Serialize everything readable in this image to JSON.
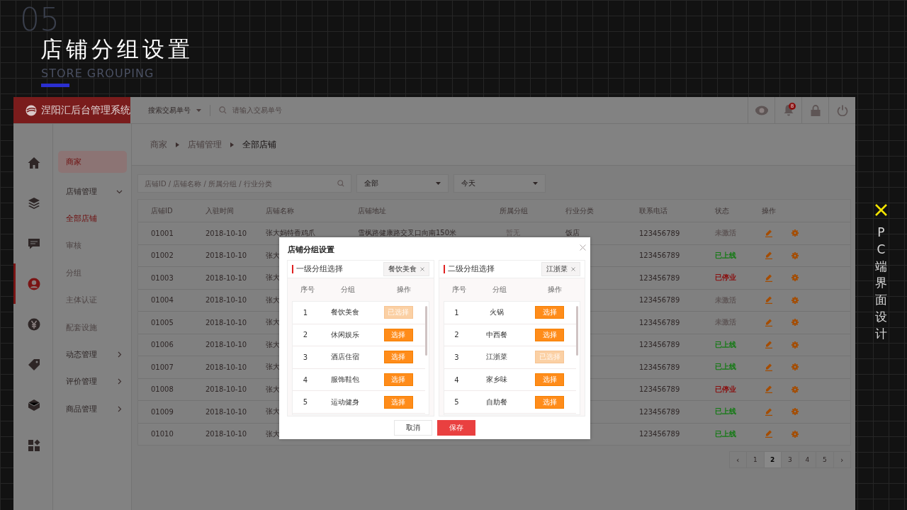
{
  "slide": {
    "number": "05",
    "title": "店铺分组设置",
    "subtitle": "STORE GROUPING",
    "side_caption": "PC端界面设计"
  },
  "app": {
    "brand": "涅阳汇后台管理系统",
    "top_bar": {
      "search_type": "搜索交易单号",
      "search_placeholder": "请输入交易单号",
      "notification_count": "8"
    },
    "rail": [
      {
        "kind": "home",
        "selected": false
      },
      {
        "kind": "layers",
        "selected": false
      },
      {
        "kind": "chat",
        "selected": false
      },
      {
        "kind": "user",
        "selected": true
      },
      {
        "kind": "yen",
        "selected": false
      },
      {
        "kind": "tag",
        "selected": false
      },
      {
        "kind": "cube",
        "selected": false
      },
      {
        "kind": "grid",
        "selected": false
      }
    ],
    "menu": [
      {
        "label": "商家",
        "kind": "link",
        "selected": true
      },
      {
        "label": "店铺管理",
        "kind": "group",
        "expanded": true,
        "children": [
          {
            "label": "全部店铺",
            "selected": true
          },
          {
            "label": "审核",
            "selected": false
          },
          {
            "label": "分组",
            "selected": false
          },
          {
            "label": "主体认证",
            "selected": false
          },
          {
            "label": "配套设施",
            "selected": false
          }
        ]
      },
      {
        "label": "动态管理",
        "kind": "group",
        "expanded": false
      },
      {
        "label": "评价管理",
        "kind": "group",
        "expanded": false
      },
      {
        "label": "商品管理",
        "kind": "group",
        "expanded": false
      }
    ],
    "breadcrumb": [
      "商家",
      "店铺管理",
      "全部店铺"
    ],
    "filters": {
      "search_placeholder": "店铺ID / 店铺名称 / 所属分组 / 行业分类",
      "category": "全部",
      "date": "今天"
    },
    "table": {
      "columns": [
        "店铺ID",
        "入驻时间",
        "店铺名称",
        "店铺地址",
        "所属分组",
        "行业分类",
        "联系电话",
        "状态",
        "操作"
      ],
      "rows": [
        {
          "id": "01001",
          "date": "2018-10-10",
          "name": "张大妈特香鸡爪",
          "address": "雪枫路健康路交叉口向南150米",
          "group": "暂无",
          "industry": "饭店",
          "phone": "123456789",
          "status": {
            "text": "未激活",
            "color": "#5f5757"
          }
        },
        {
          "id": "01002",
          "date": "2018-10-10",
          "name": "张大",
          "phone": "123456789",
          "status": {
            "text": "已上线",
            "color": "#127a12"
          }
        },
        {
          "id": "01003",
          "date": "2018-10-10",
          "name": "张大",
          "phone": "123456789",
          "status": {
            "text": "已停业",
            "color": "#8a0f0f"
          }
        },
        {
          "id": "01004",
          "date": "2018-10-10",
          "name": "张大",
          "phone": "123456789",
          "status": {
            "text": "未激活",
            "color": "#5f5757"
          }
        },
        {
          "id": "01005",
          "date": "2018-10-10",
          "name": "张大",
          "phone": "123456789",
          "status": {
            "text": "未激活",
            "color": "#5f5757"
          }
        },
        {
          "id": "01006",
          "date": "2018-10-10",
          "name": "张大",
          "phone": "123456789",
          "status": {
            "text": "已上线",
            "color": "#127a12"
          }
        },
        {
          "id": "01007",
          "date": "2018-10-10",
          "name": "张大",
          "phone": "123456789",
          "status": {
            "text": "已上线",
            "color": "#127a12"
          }
        },
        {
          "id": "01008",
          "date": "2018-10-10",
          "name": "张大",
          "phone": "123456789",
          "status": {
            "text": "已停业",
            "color": "#8a0f0f"
          }
        },
        {
          "id": "01009",
          "date": "2018-10-10",
          "name": "张大",
          "phone": "123456789",
          "status": {
            "text": "已上线",
            "color": "#127a12"
          }
        },
        {
          "id": "01010",
          "date": "2018-10-10",
          "name": "张大",
          "phone": "123456789",
          "status": {
            "text": "已上线",
            "color": "#127a12"
          }
        }
      ]
    },
    "pagination": [
      {
        "label": "‹",
        "kind": "prev",
        "selected": false
      },
      {
        "label": "1",
        "kind": "page",
        "selected": false
      },
      {
        "label": "2",
        "kind": "page",
        "selected": true
      },
      {
        "label": "3",
        "kind": "page",
        "selected": false
      },
      {
        "label": "4",
        "kind": "page",
        "selected": false
      },
      {
        "label": "5",
        "kind": "page",
        "selected": false
      },
      {
        "label": "›",
        "kind": "next",
        "selected": false
      }
    ],
    "dialog": {
      "title": "店铺分组设置",
      "panels": [
        {
          "title": "一级分组选择",
          "chosen": "餐饮美食",
          "columns": [
            "序号",
            "分组",
            "操作"
          ],
          "rows": [
            {
              "no": "1",
              "name": "餐饮美食",
              "action": "已选择",
              "selected": true
            },
            {
              "no": "2",
              "name": "休闲娱乐",
              "action": "选择",
              "selected": false
            },
            {
              "no": "3",
              "name": "酒店住宿",
              "action": "选择",
              "selected": false
            },
            {
              "no": "4",
              "name": "服饰鞋包",
              "action": "选择",
              "selected": false
            },
            {
              "no": "5",
              "name": "运动健身",
              "action": "选择",
              "selected": false
            }
          ]
        },
        {
          "title": "二级分组选择",
          "chosen": "江浙菜",
          "columns": [
            "序号",
            "分组",
            "操作"
          ],
          "rows": [
            {
              "no": "1",
              "name": "火锅",
              "action": "选择",
              "selected": false
            },
            {
              "no": "2",
              "name": "中西餐",
              "action": "选择",
              "selected": false
            },
            {
              "no": "3",
              "name": "江浙菜",
              "action": "已选择",
              "selected": true
            },
            {
              "no": "4",
              "name": "家乡味",
              "action": "选择",
              "selected": false
            },
            {
              "no": "5",
              "name": "自助餐",
              "action": "选择",
              "selected": false
            }
          ]
        }
      ],
      "cancel": "取消",
      "save": "保存"
    }
  }
}
